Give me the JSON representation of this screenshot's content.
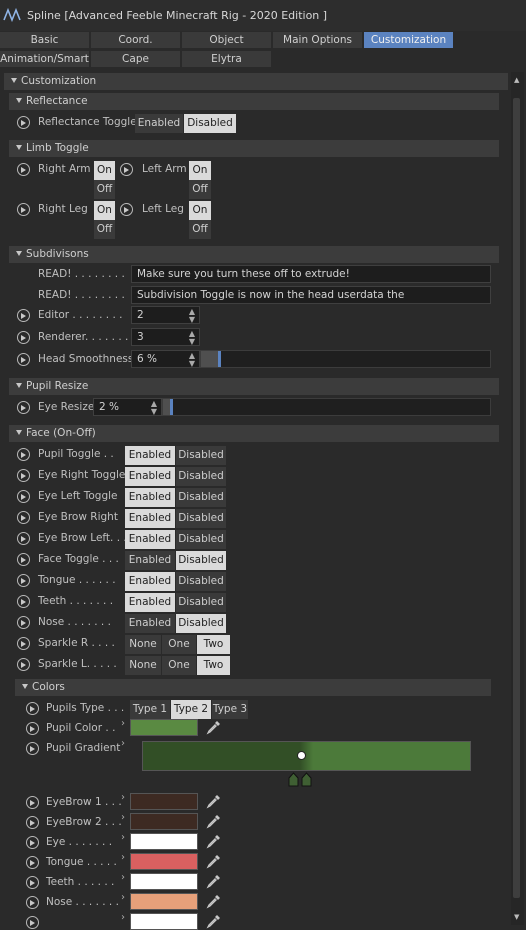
{
  "window": {
    "title": "Spline [Advanced Feeble Minecraft Rig - 2020 Edition ]"
  },
  "tabs": {
    "row1": [
      "Basic",
      "Coord.",
      "Object",
      "Main Options",
      "Customization"
    ],
    "row2": [
      "Animation/Smart",
      "Cape",
      "Elytra"
    ],
    "active": "Customization"
  },
  "sections": {
    "customization": "Customization",
    "reflectance": "Reflectance",
    "limb_toggle": "Limb Toggle",
    "subdivisions": "Subdivisons",
    "pupil_resize": "Pupil Resize",
    "face": "Face (On-Off)",
    "colors": "Colors"
  },
  "reflectance": {
    "label": "Reflectance Toggle",
    "options": [
      "Enabled",
      "Disabled"
    ],
    "selected": "Disabled"
  },
  "limbs": {
    "right_arm": "Right Arm",
    "left_arm": "Left Arm",
    "right_leg": "Right Leg",
    "left_leg": "Left Leg",
    "on": "On",
    "off": "Off"
  },
  "subdiv": {
    "read_label1": "READ! . . . . . . . .",
    "read_text1": "Make sure you turn these off to extrude!",
    "read_label2": "READ! . . . . . . . .",
    "read_text2": "Subdivision Toggle is now in the head userdata the",
    "editor_label": "Editor . . . . . . . .",
    "editor_value": "2",
    "renderer_label": "Renderer. . . . . . .",
    "renderer_value": "3",
    "smooth_label": "Head Smoothness",
    "smooth_value": "6 %",
    "smooth_fraction": 0.06
  },
  "pupil_resize": {
    "label": "Eye Resize",
    "value": "2 %",
    "fraction": 0.02
  },
  "face_toggles": [
    {
      "label": "Pupil Toggle  . .",
      "options": [
        "Enabled",
        "Disabled"
      ],
      "selected": "Enabled"
    },
    {
      "label": "Eye Right Toggle",
      "options": [
        "Enabled",
        "Disabled"
      ],
      "selected": "Enabled"
    },
    {
      "label": "Eye Left Toggle",
      "options": [
        "Enabled",
        "Disabled"
      ],
      "selected": "Enabled"
    },
    {
      "label": "Eye Brow Right",
      "options": [
        "Enabled",
        "Disabled"
      ],
      "selected": "Enabled"
    },
    {
      "label": "Eye Brow Left. . .",
      "options": [
        "Enabled",
        "Disabled"
      ],
      "selected": "Enabled"
    },
    {
      "label": "Face Toggle . . .",
      "options": [
        "Enabled",
        "Disabled"
      ],
      "selected": "Disabled"
    },
    {
      "label": "Tongue . . . . . .",
      "options": [
        "Enabled",
        "Disabled"
      ],
      "selected": "Enabled"
    },
    {
      "label": "Teeth . . . . . . .",
      "options": [
        "Enabled",
        "Disabled"
      ],
      "selected": "Enabled"
    },
    {
      "label": "Nose  . . . . . . .",
      "options": [
        "Enabled",
        "Disabled"
      ],
      "selected": "Disabled"
    },
    {
      "label": "Sparkle R  . . . .",
      "options": [
        "None",
        "One",
        "Two"
      ],
      "selected": "Two"
    },
    {
      "label": "Sparkle L. . . . .",
      "options": [
        "None",
        "One",
        "Two"
      ],
      "selected": "Two"
    }
  ],
  "colors": {
    "pupils_type": {
      "label": "Pupils Type  . . .",
      "options": [
        "Type 1",
        "Type 2",
        "Type 3"
      ],
      "selected": "Type 2"
    },
    "pupil_color": {
      "label": "Pupil Color  . .",
      "color": "#5a8a42"
    },
    "pupil_gradient": {
      "label": "Pupil Gradient",
      "color_left": "#324f26",
      "color_right": "#4c7a3a",
      "knot_color": "#3f5f33"
    },
    "swatches": [
      {
        "label": "EyeBrow 1 . . .",
        "color": "#3d2a22"
      },
      {
        "label": "EyeBrow 2 . . .",
        "color": "#3d2a22"
      },
      {
        "label": "Eye  . . . . . . .",
        "color": "#ffffff"
      },
      {
        "label": "Tongue . . . . .",
        "color": "#d96060"
      },
      {
        "label": "Teeth  . . . . . .",
        "color": "#ffffff"
      },
      {
        "label": "Nose  . . . . . . .",
        "color": "#e6a07a"
      },
      {
        "label": "",
        "color": "#ffffff"
      }
    ]
  },
  "colors_theme": {
    "accent": "#5b83c0",
    "panel": "#2a2a2a"
  }
}
